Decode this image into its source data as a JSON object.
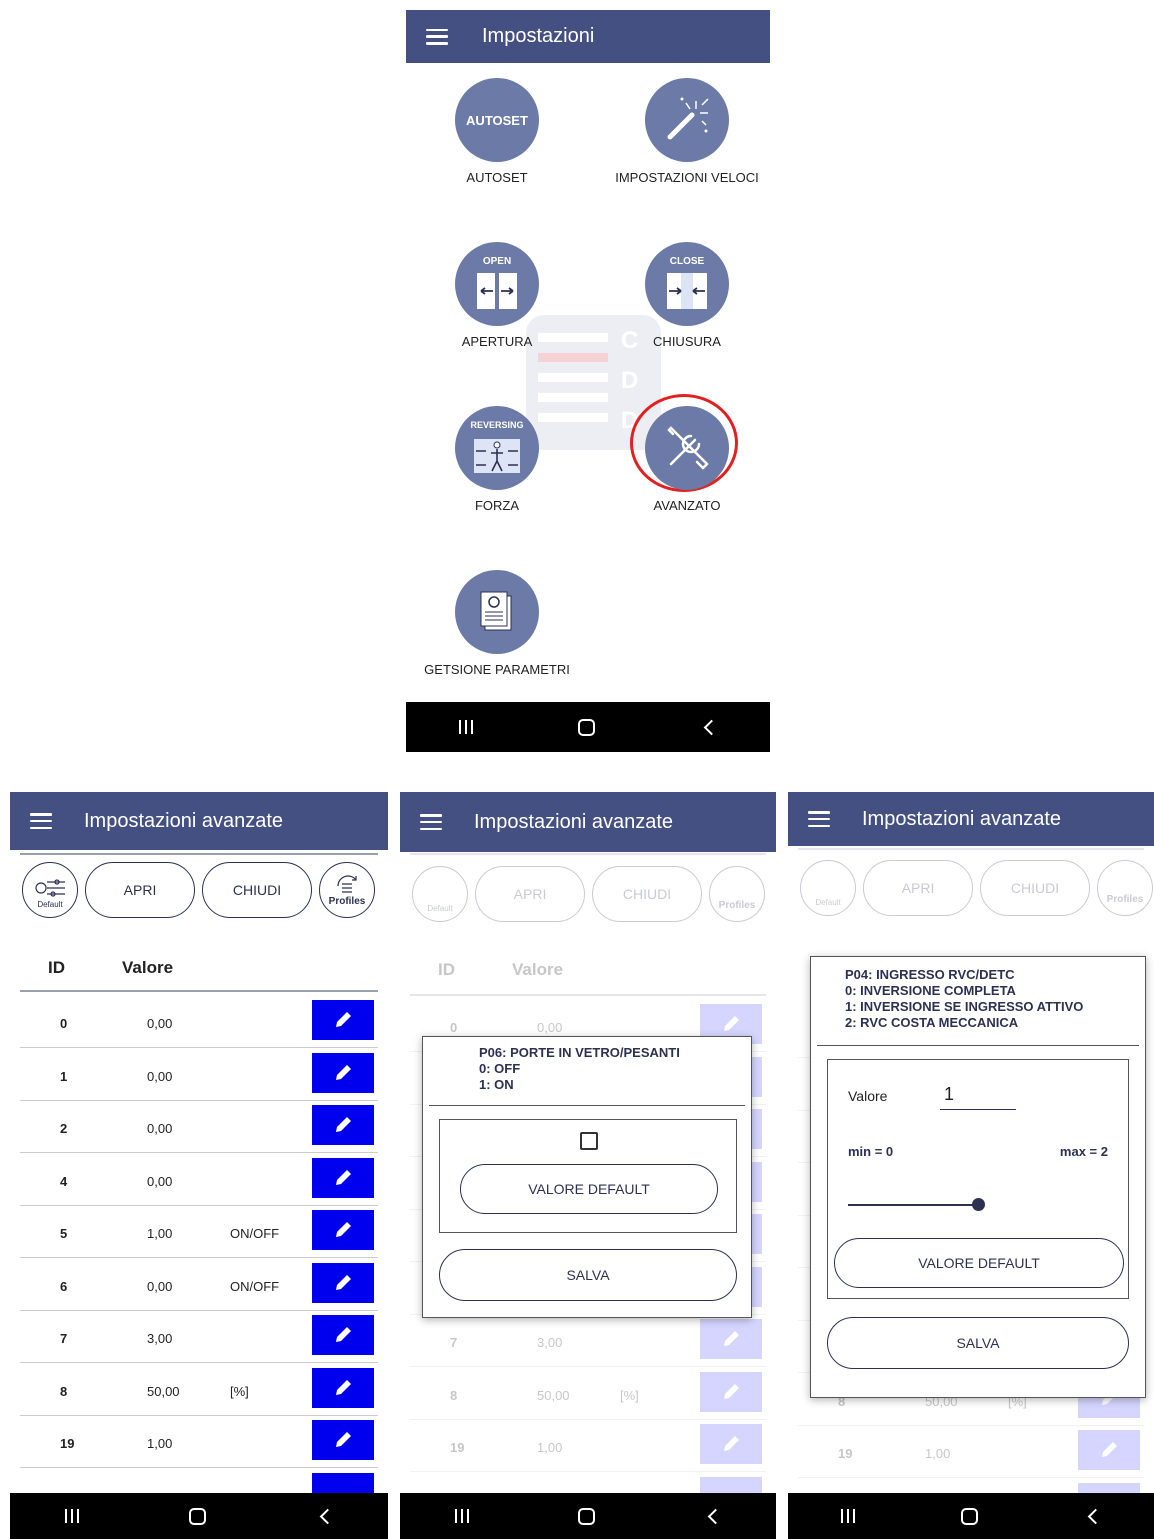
{
  "screen_top": {
    "title": "Impostazioni",
    "tiles": [
      {
        "label": "AUTOSET",
        "icon": "autoset-icon",
        "tag": "AUTOSET"
      },
      {
        "label": "IMPOSTAZIONI VELOCI",
        "icon": "magic-wand-icon"
      },
      {
        "label": "APERTURA",
        "icon": "door-open-icon",
        "tag": "OPEN"
      },
      {
        "label": "CHIUSURA",
        "icon": "door-close-icon",
        "tag": "CLOSE"
      },
      {
        "label": "FORZA",
        "icon": "reversing-icon",
        "tag": "REVERSING"
      },
      {
        "label": "AVANZATO",
        "icon": "wrench-screwdriver-icon"
      },
      {
        "label": "GETSIONE PARAMETRI",
        "icon": "document-gear-icon"
      }
    ],
    "watermark_letters": [
      "C",
      "D",
      "D"
    ]
  },
  "advanced": {
    "title": "Impostazioni avanzate",
    "default_label": "Default",
    "apri": "APRI",
    "chiudi": "CHIUDI",
    "profiles_label": "Profiles",
    "col_id": "ID",
    "col_value": "Valore",
    "rows": [
      {
        "id": "0",
        "value": "0,00",
        "unit": ""
      },
      {
        "id": "1",
        "value": "0,00",
        "unit": ""
      },
      {
        "id": "2",
        "value": "0,00",
        "unit": ""
      },
      {
        "id": "4",
        "value": "0,00",
        "unit": ""
      },
      {
        "id": "5",
        "value": "1,00",
        "unit": "ON/OFF"
      },
      {
        "id": "6",
        "value": "0,00",
        "unit": "ON/OFF"
      },
      {
        "id": "7",
        "value": "3,00",
        "unit": ""
      },
      {
        "id": "8",
        "value": "50,00",
        "unit": "[%]"
      },
      {
        "id": "19",
        "value": "1,00",
        "unit": ""
      }
    ]
  },
  "dialog_p06": {
    "line1": "P06:  PORTE IN VETRO/PESANTI",
    "line2": "0: OFF",
    "line3": "1: ON",
    "default_button": "VALORE DEFAULT",
    "save_button": "SALVA"
  },
  "dialog_p04": {
    "line1": "P04: INGRESSO RVC/DETC",
    "line2": "0: INVERSIONE COMPLETA",
    "line3": "1: INVERSIONE SE INGRESSO ATTIVO",
    "line4": "2: RVC COSTA MECCANICA",
    "value_label": "Valore",
    "value": "1",
    "min_label": "min = 0",
    "max_label": "max = 2",
    "slider_fraction": 0.5,
    "default_button": "VALORE DEFAULT",
    "save_button": "SALVA"
  },
  "colors": {
    "appbar": "#455082",
    "icon_circle": "#6b7aa6",
    "edit_button": "#0000ee",
    "highlight": "#e32020"
  }
}
